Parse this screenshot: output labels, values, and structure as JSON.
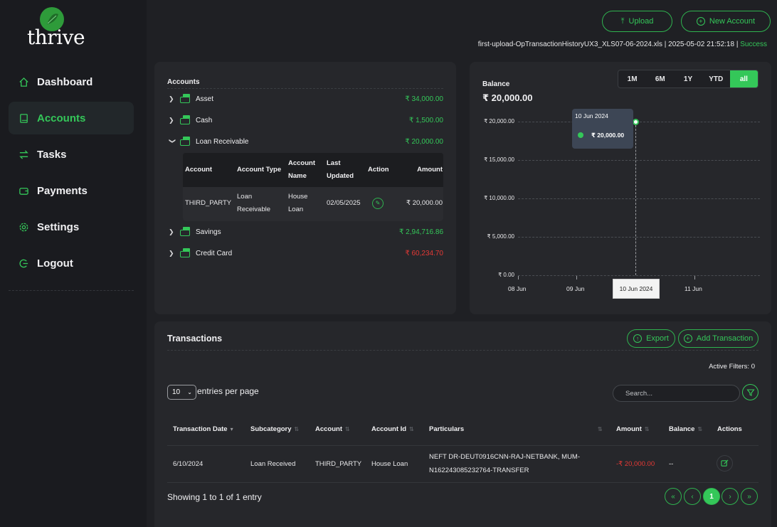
{
  "app": {
    "logo_text": "thrive"
  },
  "sidebar": {
    "items": [
      {
        "label": "Dashboard",
        "icon": "home-icon"
      },
      {
        "label": "Accounts",
        "icon": "book-icon",
        "active": true
      },
      {
        "label": "Tasks",
        "icon": "swap-icon"
      },
      {
        "label": "Payments",
        "icon": "wallet-icon"
      },
      {
        "label": "Settings",
        "icon": "gear-icon"
      },
      {
        "label": "Logout",
        "icon": "logout-icon"
      }
    ]
  },
  "header": {
    "upload_label": "Upload",
    "new_account_label": "New Account",
    "file_name": "first-upload-OpTransactionHistoryUX3_XLS07-06-2024.xls",
    "file_time": "2025-05-02 21:52:18",
    "separator": "|",
    "file_status": "Success"
  },
  "accounts": {
    "title": "Accounts",
    "rows": [
      {
        "name": "Asset",
        "amount": "₹ 34,000.00",
        "expanded": false
      },
      {
        "name": "Cash",
        "amount": "₹ 1,500.00",
        "expanded": false
      },
      {
        "name": "Loan Receivable",
        "amount": "₹ 20,000.00",
        "expanded": true
      },
      {
        "name": "Savings",
        "amount": "₹ 2,94,716.86",
        "expanded": false
      },
      {
        "name": "Credit Card",
        "amount": "₹ 60,234.70",
        "expanded": false,
        "negative": true
      }
    ],
    "sub_table": {
      "headers": {
        "account": "Account",
        "account_type": "Account Type",
        "account_name_1": "Account",
        "account_name_2": "Name",
        "last_updated_1": "Last",
        "last_updated_2": "Updated",
        "action": "Action",
        "amount": "Amount"
      },
      "row": {
        "account": "THIRD_PARTY",
        "account_type_1": "Loan",
        "account_type_2": "Receivable",
        "account_name_1": "House",
        "account_name_2": "Loan",
        "last_updated": "02/05/2025",
        "amount": "₹ 20,000.00"
      }
    }
  },
  "balance": {
    "title": "Balance",
    "value": "₹ 20,000.00",
    "ranges": [
      {
        "label": "1M"
      },
      {
        "label": "6M"
      },
      {
        "label": "1Y"
      },
      {
        "label": "YTD"
      },
      {
        "label": "all",
        "active": true
      }
    ],
    "tooltip": {
      "date": "10 Jun 2024",
      "value": "₹ 20,000.00"
    },
    "x_tooltip": "10 Jun 2024"
  },
  "chart_data": {
    "type": "line",
    "title": "Balance",
    "y_ticks": [
      "₹ 0.00",
      "₹ 5,000.00",
      "₹ 10,000.00",
      "₹ 15,000.00",
      "₹ 20,000.00"
    ],
    "x_ticks": [
      "08 Jun",
      "09 Jun",
      "11 Jun"
    ],
    "ylim": [
      0,
      20000
    ],
    "series": [
      {
        "x": [
          "10 Jun 2024"
        ],
        "values": [
          20000
        ]
      }
    ],
    "grid": true,
    "accent": "#34c759"
  },
  "transactions": {
    "title": "Transactions",
    "export_label": "Export",
    "add_label": "Add Transaction",
    "active_filters": "Active Filters: 0",
    "page_size": "10",
    "entries_label": "entries per page",
    "search_placeholder": "Search...",
    "headers": [
      "Transaction Date",
      "Subcategory",
      "Account",
      "Account Id",
      "Particulars",
      "Amount",
      "Balance",
      "Actions"
    ],
    "rows": [
      {
        "date": "6/10/2024",
        "subcategory": "Loan Received",
        "account": "THIRD_PARTY",
        "account_id": "House Loan",
        "particulars_1": "NEFT DR-DEUT0916CNN-RAJ-NETBANK, MUM-",
        "particulars_2": "N162243085232764-TRANSFER",
        "amount": "-₹ 20,000.00",
        "balance": "--"
      }
    ],
    "showing": "Showing 1 to 1 of 1 entry",
    "pagination": {
      "first": "«",
      "prev": "‹",
      "current": "1",
      "next": "›",
      "last": "»"
    }
  }
}
